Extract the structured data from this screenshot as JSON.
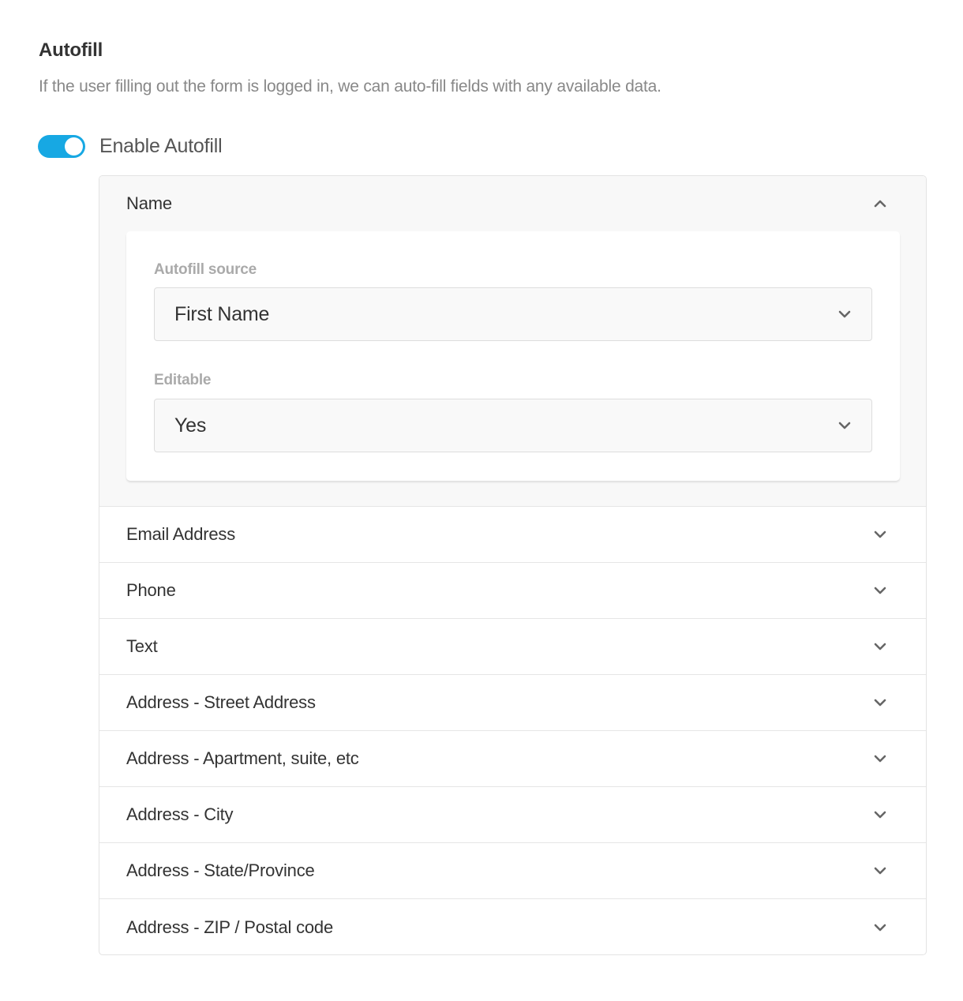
{
  "autofill": {
    "title": "Autofill",
    "description": "If the user filling out the form is logged in, we can auto-fill fields with any available data.",
    "toggle": {
      "label": "Enable Autofill",
      "enabled": true,
      "color": "#17a8e3"
    }
  },
  "accordion": {
    "open_item": {
      "label": "Name",
      "fields": {
        "source_label": "Autofill source",
        "source_value": "First Name",
        "editable_label": "Editable",
        "editable_value": "Yes"
      }
    },
    "items": [
      {
        "label": "Email Address"
      },
      {
        "label": "Phone"
      },
      {
        "label": "Text"
      },
      {
        "label": "Address - Street Address"
      },
      {
        "label": "Address - Apartment, suite, etc"
      },
      {
        "label": "Address - City"
      },
      {
        "label": "Address - State/Province"
      },
      {
        "label": "Address - ZIP / Postal code"
      }
    ]
  },
  "icons": {
    "expand": "chevron-down-icon",
    "collapse": "chevron-up-icon"
  }
}
